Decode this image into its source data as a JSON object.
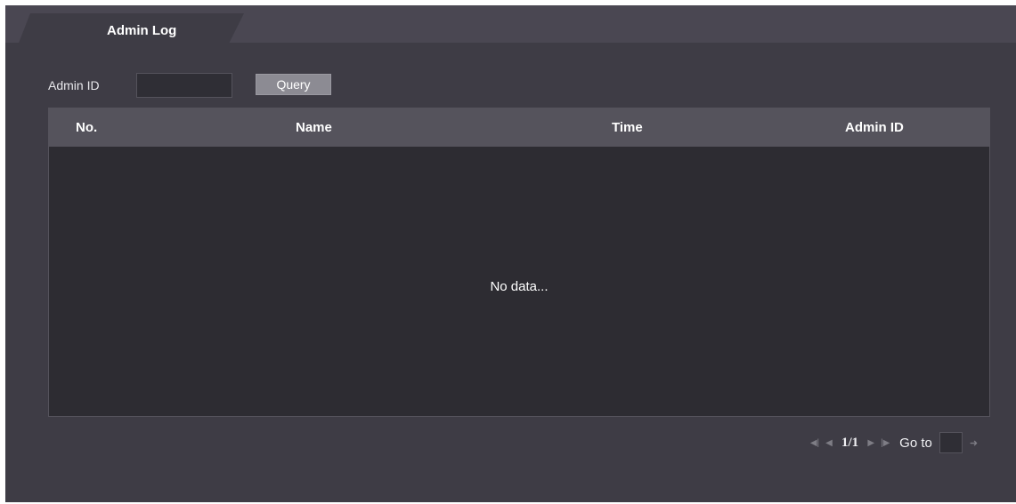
{
  "tab": {
    "label": "Admin Log"
  },
  "filter": {
    "label": "Admin ID",
    "value": "",
    "query_label": "Query"
  },
  "table": {
    "columns": [
      "No.",
      "Name",
      "Time",
      "Admin ID"
    ],
    "empty_message": "No data..."
  },
  "pagination": {
    "page": "1/1",
    "goto_label": "Go to",
    "goto_value": ""
  },
  "icons": {
    "first": "first-page-icon",
    "prev": "previous-page-icon",
    "next": "next-page-icon",
    "last": "last-page-icon",
    "go": "go-arrow-icon"
  },
  "colors": {
    "background": "#3e3c45",
    "tabbar": "#4a4752",
    "table_header": "#55535c",
    "table_body": "#2d2c32",
    "button": "#8c8b93"
  }
}
